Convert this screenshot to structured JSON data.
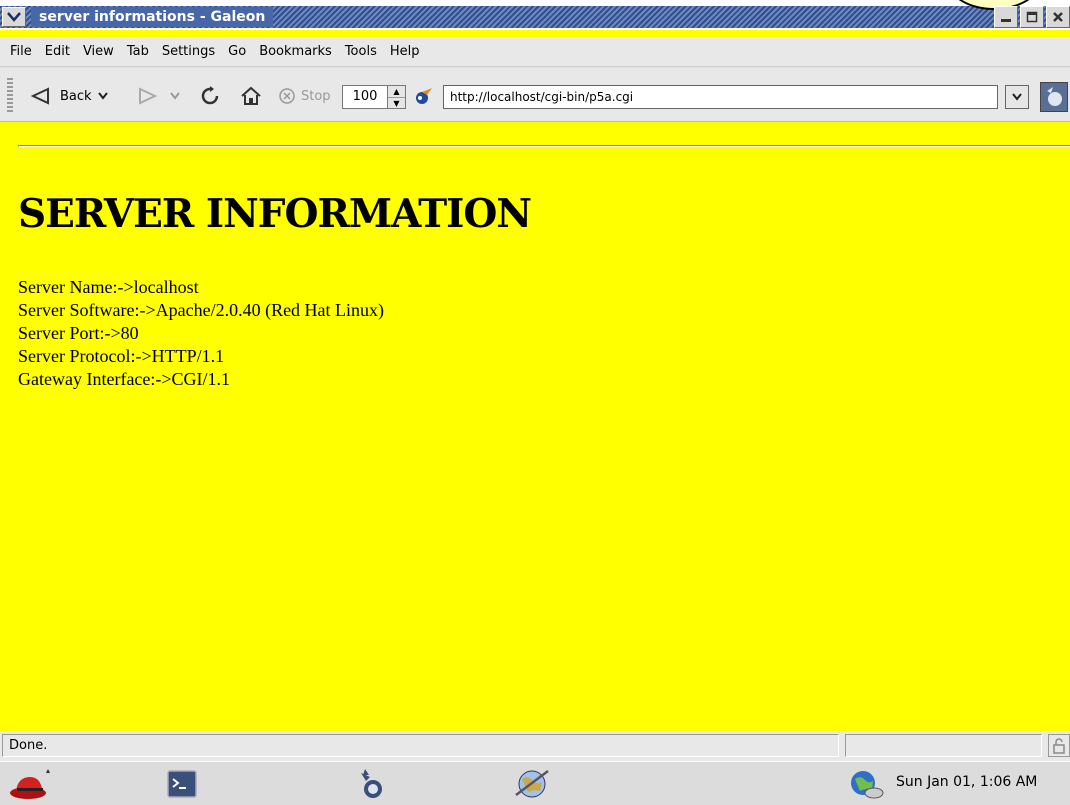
{
  "window": {
    "title": "server informations - Galeon",
    "title_bar_color": "#4767a8"
  },
  "menu": {
    "items": [
      {
        "label": "File",
        "key": "F"
      },
      {
        "label": "Edit",
        "key": "E"
      },
      {
        "label": "View",
        "key": "V"
      },
      {
        "label": "Tab",
        "key": "T"
      },
      {
        "label": "Settings",
        "key": "S"
      },
      {
        "label": "Go",
        "key": "G"
      },
      {
        "label": "Bookmarks",
        "key": "B"
      },
      {
        "label": "Tools",
        "key": "o"
      },
      {
        "label": "Help",
        "key": "H"
      }
    ]
  },
  "toolbar": {
    "back_label": "Back",
    "stop_label": "Stop",
    "zoom_value": "100",
    "url": "http://localhost/cgi-bin/p5a.cgi"
  },
  "page": {
    "background": "#ffff00",
    "heading": "SERVER INFORMATION",
    "lines": [
      "Server Name:->localhost",
      "Server Software:->Apache/2.0.40 (Red Hat Linux)",
      "Server Port:->80",
      "Server Protocol:->HTTP/1.1",
      "Gateway Interface:->CGI/1.1"
    ]
  },
  "statusbar": {
    "text": "Done."
  },
  "panel": {
    "clock": "Sun Jan 01,  1:06 AM",
    "launchers": [
      "redhat-menu-icon",
      "terminal-icon",
      "galeon-icon",
      "web-browser-icon",
      "network-globe-icon"
    ]
  }
}
